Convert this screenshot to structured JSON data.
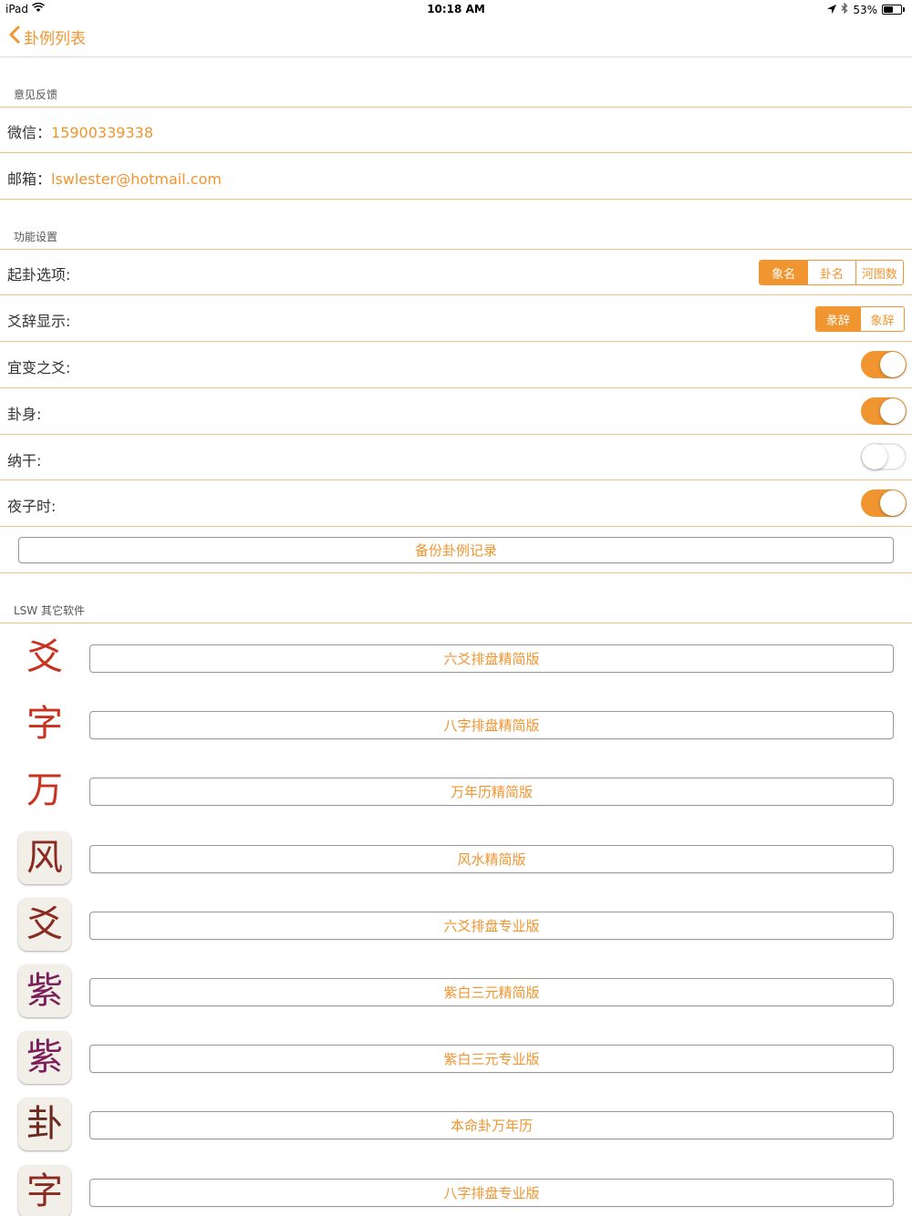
{
  "status_bar": {
    "device": "iPad",
    "time": "10:18 AM",
    "battery_text": "53%",
    "battery_level": 0.53
  },
  "nav": {
    "back_label": "卦例列表"
  },
  "feedback": {
    "header": "意见反馈",
    "wechat_label": "微信：",
    "wechat_value": "15900339338",
    "email_label": "邮箱：",
    "email_value": "lswlester@hotmail.com"
  },
  "settings": {
    "header": "功能设置",
    "qigua": {
      "label": "起卦选项:",
      "options": [
        "象名",
        "卦名",
        "河图数"
      ],
      "selected": 0
    },
    "yaoci": {
      "label": "爻辞显示:",
      "options": [
        "彖辞",
        "象辞"
      ],
      "selected": 0
    },
    "yibian": {
      "label": "宜变之爻:",
      "on": true
    },
    "guashen": {
      "label": "卦身:",
      "on": true
    },
    "nagan": {
      "label": "纳干:",
      "on": false
    },
    "yezishi": {
      "label": "夜子时:",
      "on": true
    },
    "backup_label": "备份卦例记录"
  },
  "other_apps": {
    "header": "LSW 其它软件",
    "items": [
      {
        "label": "六爻排盘精简版",
        "icon_glyph": "爻",
        "icon_color": "#c8321e",
        "icon_frame": false
      },
      {
        "label": "八字排盘精简版",
        "icon_glyph": "字",
        "icon_color": "#c8321e",
        "icon_frame": false
      },
      {
        "label": "万年历精简版",
        "icon_glyph": "万",
        "icon_color": "#c8321e",
        "icon_frame": false
      },
      {
        "label": "风水精简版",
        "icon_glyph": "风",
        "icon_color": "#8a2a20",
        "icon_frame": true
      },
      {
        "label": "六爻排盘专业版",
        "icon_glyph": "爻",
        "icon_color": "#8a2a20",
        "icon_frame": true
      },
      {
        "label": "紫白三元精简版",
        "icon_glyph": "紫",
        "icon_color": "#7a1f5a",
        "icon_frame": true
      },
      {
        "label": "紫白三元专业版",
        "icon_glyph": "紫",
        "icon_color": "#7a1f5a",
        "icon_frame": true
      },
      {
        "label": "本命卦万年历",
        "icon_glyph": "卦",
        "icon_color": "#6a2a20",
        "icon_frame": true
      },
      {
        "label": "八字排盘专业版",
        "icon_glyph": "字",
        "icon_color": "#8a2a20",
        "icon_frame": true
      }
    ]
  },
  "colors": {
    "accent": "#f0952f",
    "divider": "#f2c08a"
  }
}
